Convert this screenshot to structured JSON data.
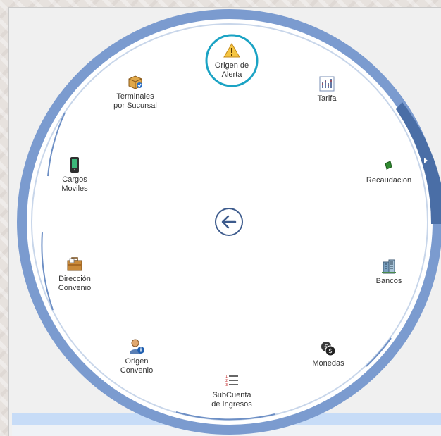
{
  "window": {
    "background": "#f0f0f0",
    "band_color": "#c7dcf7"
  },
  "radial_menu": {
    "ring_color": "#7b9bcf",
    "accent_color": "#4a6ea6",
    "highlight_color": "#1ba3c4",
    "back_button_icon": "arrow-left-icon",
    "expand_icon": "chevron-right-icon",
    "items": [
      {
        "id": "origen-alerta",
        "label": "Origen de\nAlerta",
        "icon": "warning-icon",
        "selected": true
      },
      {
        "id": "tarifa",
        "label": "Tarifa",
        "icon": "chart-icon",
        "selected": false
      },
      {
        "id": "recaudacion",
        "label": "Recaudacion",
        "icon": "money-icon",
        "selected": false
      },
      {
        "id": "bancos",
        "label": "Bancos",
        "icon": "bank-building-icon",
        "selected": false
      },
      {
        "id": "monedas",
        "label": "Monedas",
        "icon": "coins-icon",
        "selected": false
      },
      {
        "id": "subcuenta-ingresos",
        "label": "SubCuenta\nde Ingresos",
        "icon": "numbered-list-icon",
        "selected": false
      },
      {
        "id": "origen-convenio",
        "label": "Origen\nConvenio",
        "icon": "user-info-icon",
        "selected": false
      },
      {
        "id": "direccion-convenio",
        "label": "Dirección\nConvenio",
        "icon": "briefcase-icon",
        "selected": false
      },
      {
        "id": "cargos-moviles",
        "label": "Cargos\nMoviles",
        "icon": "mobile-device-icon",
        "selected": false
      },
      {
        "id": "terminales-sucursal",
        "label": "Terminales\npor Sucursal",
        "icon": "package-icon",
        "selected": false
      }
    ]
  }
}
